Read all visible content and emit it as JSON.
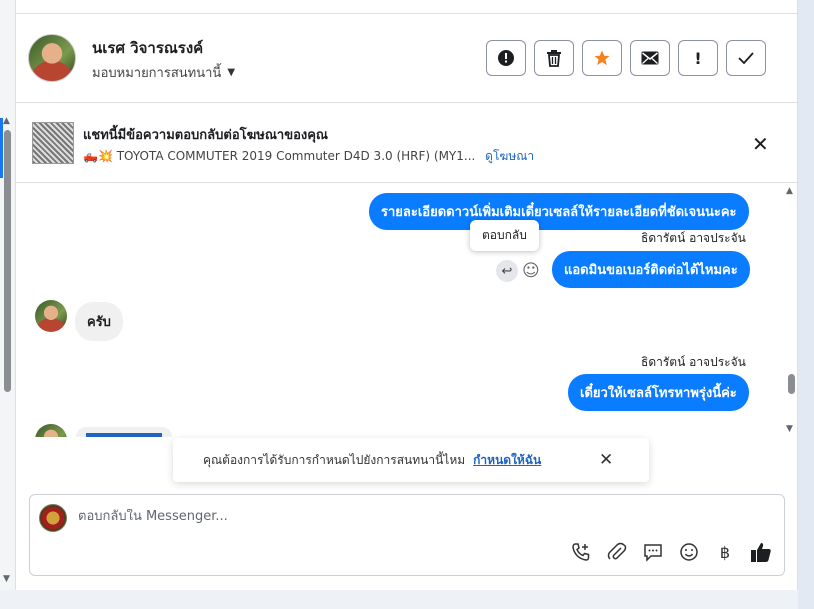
{
  "header": {
    "contact_name": "นเรศ วิจารณรงค์",
    "assign_label": "มอบหมายการสนทนานี้",
    "actions": [
      {
        "name": "alert-circle-icon",
        "glyph": "❗"
      },
      {
        "name": "trash-icon",
        "glyph": "🗑"
      },
      {
        "name": "star-icon",
        "glyph": "★"
      },
      {
        "name": "mail-icon",
        "glyph": "✉"
      },
      {
        "name": "exclamation-icon",
        "glyph": "!"
      },
      {
        "name": "check-icon",
        "glyph": "✓"
      }
    ]
  },
  "ad": {
    "title": "แชทนี้มีข้อความตอบกลับต่อโฆษณาของคุณ",
    "subtitle": "🛻💥 TOYOTA COMMUTER 2019 Commuter D4D 3.0 (HRF) (MY1...",
    "link": "ดูโฆษณา"
  },
  "messages": {
    "m1_text": "รายละเอียดดาวน์เพิ่มเติมเดี๋ยวเซลล์ให้รายละเอียดที่ชัดเจนนะคะ",
    "sender1": "ธิดารัตน์ อาจประจัน",
    "tooltip": "ตอบกลับ",
    "m2_text": "แอดมินขอเบอร์ติดต่อได้ไหมคะ",
    "in1_text": "ครับ",
    "sender2": "ธิดารัตน์ อาจประจัน",
    "m3_text": "เดี๋ยวให้เซลล์โทรหาพรุ่งนี้ค่ะ"
  },
  "notice": {
    "text": "คุณต้องการได้รับการกำหนดไปยังการสนทนานี้ไหม",
    "link": "กำหนดให้ฉัน"
  },
  "composer": {
    "placeholder": "ตอบกลับใน Messenger..."
  },
  "colors": {
    "outgoing_bubble": "#0a7cff",
    "incoming_bubble": "#f0f0f0",
    "link": "#1d65c1",
    "star": "#f5821f"
  }
}
